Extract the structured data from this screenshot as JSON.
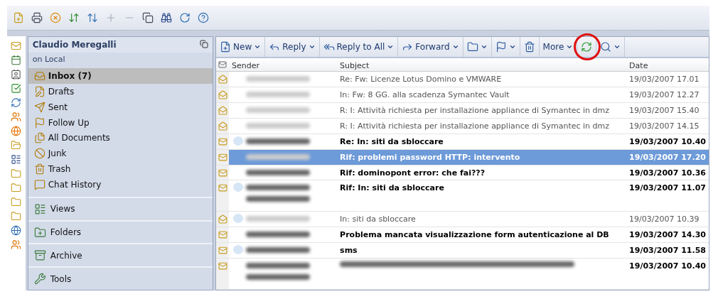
{
  "navigator": {
    "title": "Claudio Meregalli",
    "location": "on Local",
    "folders": [
      {
        "label": "Inbox (7)",
        "selected": true
      },
      {
        "label": "Drafts",
        "selected": false
      },
      {
        "label": "Sent",
        "selected": false
      },
      {
        "label": "Follow Up",
        "selected": false
      },
      {
        "label": "All Documents",
        "selected": false
      },
      {
        "label": "Junk",
        "selected": false
      },
      {
        "label": "Trash",
        "selected": false
      },
      {
        "label": "Chat History",
        "selected": false
      }
    ],
    "sections": [
      {
        "label": "Views"
      },
      {
        "label": "Folders"
      },
      {
        "label": "Archive"
      },
      {
        "label": "Tools"
      }
    ]
  },
  "actions": [
    {
      "label": "New",
      "menu": true,
      "highlighted": false
    },
    {
      "label": "Reply",
      "menu": true,
      "highlighted": false
    },
    {
      "label": "Reply to All",
      "menu": true,
      "highlighted": false
    },
    {
      "label": "Forward",
      "menu": true,
      "highlighted": false
    },
    {
      "menu": true,
      "highlighted": false
    },
    {
      "menu": true,
      "highlighted": false
    },
    {
      "menu": false,
      "highlighted": false
    },
    {
      "label": "More",
      "menu": true,
      "highlighted": false
    },
    {
      "menu": false,
      "highlighted": true
    },
    {
      "menu": true,
      "highlighted": false
    }
  ],
  "table": {
    "columns": [
      "Sender",
      "Subject",
      "Date"
    ],
    "rows": [
      {
        "subject": "Re: Fw: Licenze Lotus Domino e VMWARE",
        "date": "19/03/2007 17.01",
        "unread": false,
        "selected": false,
        "presence": false,
        "kind": "single"
      },
      {
        "subject": "In: Fw: 8 GG. alla scadenza Symantec Vault",
        "date": "19/03/2007 12.27",
        "unread": false,
        "selected": false,
        "presence": false,
        "kind": "single"
      },
      {
        "subject": "R: I: Attività richiesta per installazione appliance di Symantec in dmz",
        "date": "19/03/2007 15.40",
        "unread": false,
        "selected": false,
        "presence": false,
        "kind": "single"
      },
      {
        "subject": "R: I: Attività richiesta per installazione appliance di Symantec in dmz",
        "date": "19/03/2007 14.15",
        "unread": false,
        "selected": false,
        "presence": false,
        "kind": "single"
      },
      {
        "subject": "Re: In: siti da sbloccare",
        "date": "19/03/2007 10.40",
        "unread": true,
        "selected": false,
        "presence": true,
        "kind": "single"
      },
      {
        "subject": "Rif: problemi password HTTP: intervento",
        "date": "19/03/2007 17.20",
        "unread": true,
        "selected": true,
        "presence": false,
        "kind": "single"
      },
      {
        "subject": "Rif: dominopont error: che fai???",
        "date": "19/03/2007 10.36",
        "unread": true,
        "selected": false,
        "presence": false,
        "kind": "single"
      },
      {
        "subject": "Rif: In: siti da sbloccare",
        "date": "19/03/2007 11.07",
        "unread": true,
        "selected": false,
        "presence": true,
        "kind": "wrapped"
      },
      {
        "subject": "In: siti da sbloccare",
        "date": "19/03/2007 10.39",
        "unread": false,
        "selected": false,
        "presence": true,
        "kind": "single"
      },
      {
        "subject": "Problema mancata visualizzazione form autenticazione al DB",
        "date": "19/03/2007 14.30",
        "unread": true,
        "selected": false,
        "presence": false,
        "kind": "single"
      },
      {
        "subject": "sms",
        "date": "19/03/2007 11.58",
        "unread": true,
        "selected": false,
        "presence": true,
        "kind": "single"
      },
      {
        "date": "19/03/2007 10.40",
        "unread": true,
        "selected": false,
        "presence": false,
        "kind": "wrapped"
      }
    ]
  }
}
